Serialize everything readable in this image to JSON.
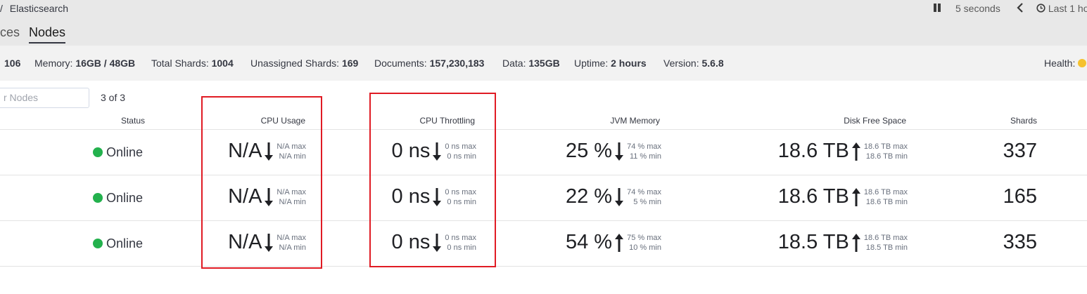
{
  "breadcrumb": {
    "separator": "/",
    "current": "Elasticsearch"
  },
  "controls": {
    "refresh_interval": "5 seconds",
    "time_range": "Last 1 ho"
  },
  "tabs": [
    {
      "label": "ces",
      "active": false
    },
    {
      "label": "Nodes",
      "active": true
    }
  ],
  "stats": {
    "nodes_value": "106",
    "memory_label": "Memory:",
    "memory_value": "16GB / 48GB",
    "total_shards_label": "Total Shards:",
    "total_shards_value": "1004",
    "unassigned_label": "Unassigned Shards:",
    "unassigned_value": "169",
    "documents_label": "Documents:",
    "documents_value": "157,230,183",
    "data_label": "Data:",
    "data_value": "135GB",
    "uptime_label": "Uptime:",
    "uptime_value": "2 hours",
    "version_label": "Version:",
    "version_value": "5.6.8",
    "health_label": "Health:",
    "health_color": "#f5c12e"
  },
  "filter": {
    "placeholder": "r Nodes",
    "count": "3 of 3"
  },
  "columns": {
    "status": "Status",
    "cpu_usage": "CPU Usage",
    "cpu_throttling": "CPU Throttling",
    "jvm_memory": "JVM Memory",
    "disk_free": "Disk Free Space",
    "shards": "Shards"
  },
  "rows": [
    {
      "status": "Online",
      "cpu": {
        "value": "N/A",
        "trend": "down",
        "max": "N/A max",
        "min": "N/A min"
      },
      "throttle": {
        "value": "0 ns",
        "trend": "down",
        "max": "0 ns max",
        "min": "0 ns min"
      },
      "jvm": {
        "value": "25 %",
        "trend": "down",
        "max": "74 % max",
        "min": "11 % min"
      },
      "disk": {
        "value": "18.6 TB",
        "trend": "up",
        "max": "18.6 TB max",
        "min": "18.6 TB min"
      },
      "shards": "337"
    },
    {
      "status": "Online",
      "cpu": {
        "value": "N/A",
        "trend": "down",
        "max": "N/A max",
        "min": "N/A min"
      },
      "throttle": {
        "value": "0 ns",
        "trend": "down",
        "max": "0 ns max",
        "min": "0 ns min"
      },
      "jvm": {
        "value": "22 %",
        "trend": "down",
        "max": "74 % max",
        "min": "5 % min"
      },
      "disk": {
        "value": "18.6 TB",
        "trend": "up",
        "max": "18.6 TB max",
        "min": "18.6 TB min"
      },
      "shards": "165"
    },
    {
      "status": "Online",
      "cpu": {
        "value": "N/A",
        "trend": "down",
        "max": "N/A max",
        "min": "N/A min"
      },
      "throttle": {
        "value": "0 ns",
        "trend": "down",
        "max": "0 ns max",
        "min": "0 ns min"
      },
      "jvm": {
        "value": "54 %",
        "trend": "up",
        "max": "75 % max",
        "min": "10 % min"
      },
      "disk": {
        "value": "18.5 TB",
        "trend": "up",
        "max": "18.6 TB max",
        "min": "18.5 TB min"
      },
      "shards": "335"
    }
  ],
  "colors": {
    "online": "#23b14d",
    "highlight_box": "#e01b24"
  }
}
